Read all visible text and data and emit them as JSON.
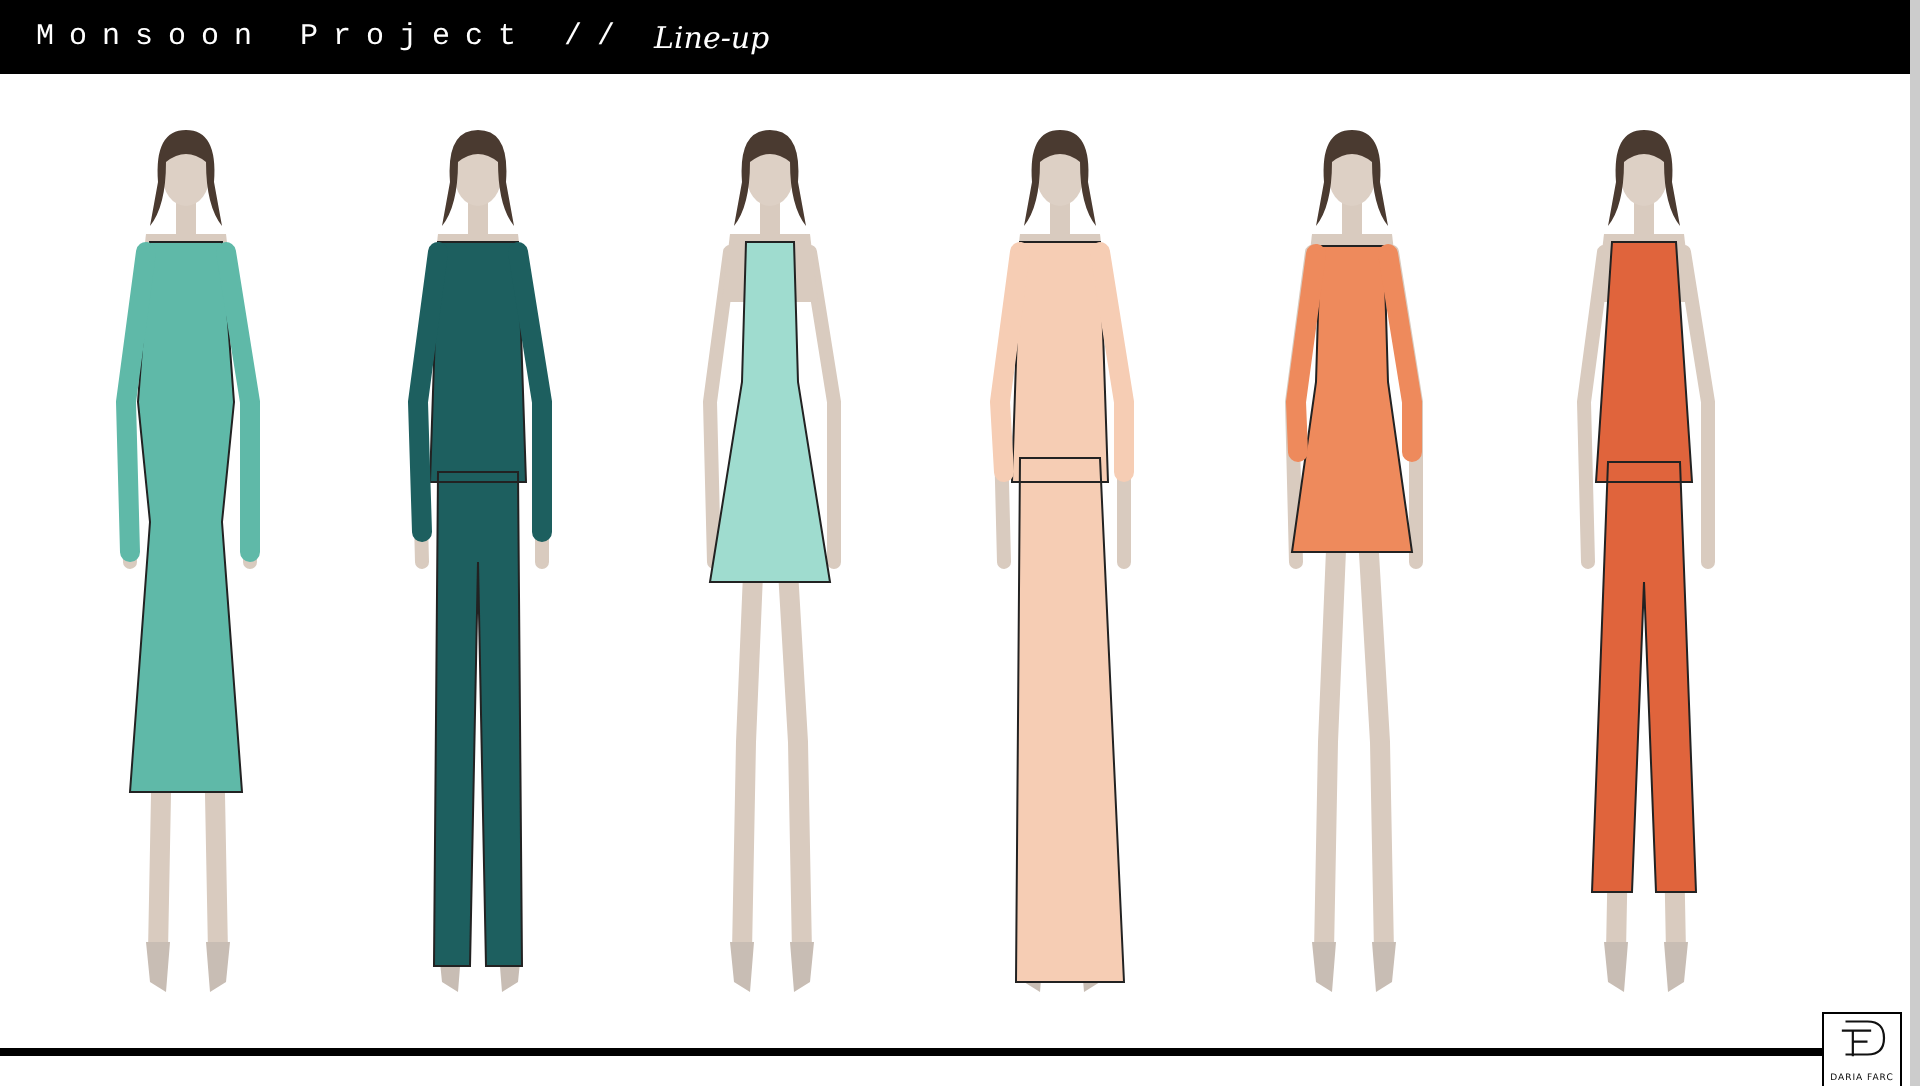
{
  "header": {
    "title": "Monsoon Project //",
    "subtitle": "Line-up"
  },
  "figures": [
    {
      "kind": "long-dress",
      "color": "#5fb9a8"
    },
    {
      "kind": "suit",
      "color": "#1d5f5f"
    },
    {
      "kind": "mini-dress",
      "color": "#9fdccf"
    },
    {
      "kind": "blazer-gown",
      "color": "#f6cdb4"
    },
    {
      "kind": "sleeved-mini-dress",
      "color": "#ee8a5c"
    },
    {
      "kind": "top-and-pants",
      "color": "#e0643c"
    }
  ],
  "logo": {
    "caption": "DARIA FARC"
  }
}
